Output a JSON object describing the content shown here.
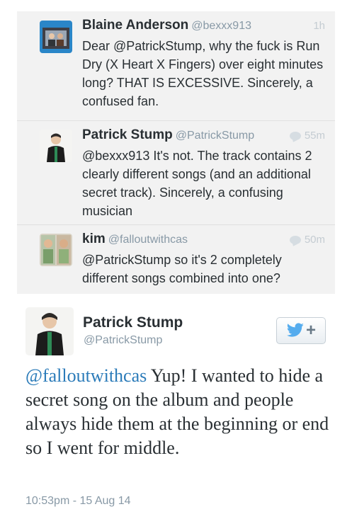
{
  "thread": [
    {
      "name": "Blaine Anderson",
      "handle": "@bexxx913",
      "time": "1h",
      "text": "Dear @PatrickStump, why the fuck is Run Dry (X Heart X Fingers) over eight minutes long? THAT IS EXCESSIVE. Sincerely, a confused fan."
    },
    {
      "name": "Patrick Stump",
      "handle": "@PatrickStump",
      "time": "55m",
      "text": "@bexxx913 It's not. The track contains 2 clearly different songs (and an additional secret track). Sincerely, a confusing musician"
    },
    {
      "name": "kim",
      "handle": "@falloutwithcas",
      "time": "50m",
      "text": "@PatrickStump so it's 2 completely different songs combined into one?"
    }
  ],
  "main_tweet": {
    "name": "Patrick Stump",
    "handle": "@PatrickStump",
    "mention": "@falloutwithcas",
    "text": " Yup! I wanted to hide a secret song on the album and people always hide them at the beginning or end so I went for middle.",
    "timestamp": "10:53pm - 15 Aug 14",
    "follow_plus": "+"
  },
  "colors": {
    "twitter_blue": "#55acee",
    "mention_blue": "#2b7bb9",
    "muted_gray": "#8899a6",
    "thread_bg": "#f2f2f2"
  },
  "icons": [
    "twitter-bird-icon",
    "reply-bubble-icon"
  ]
}
